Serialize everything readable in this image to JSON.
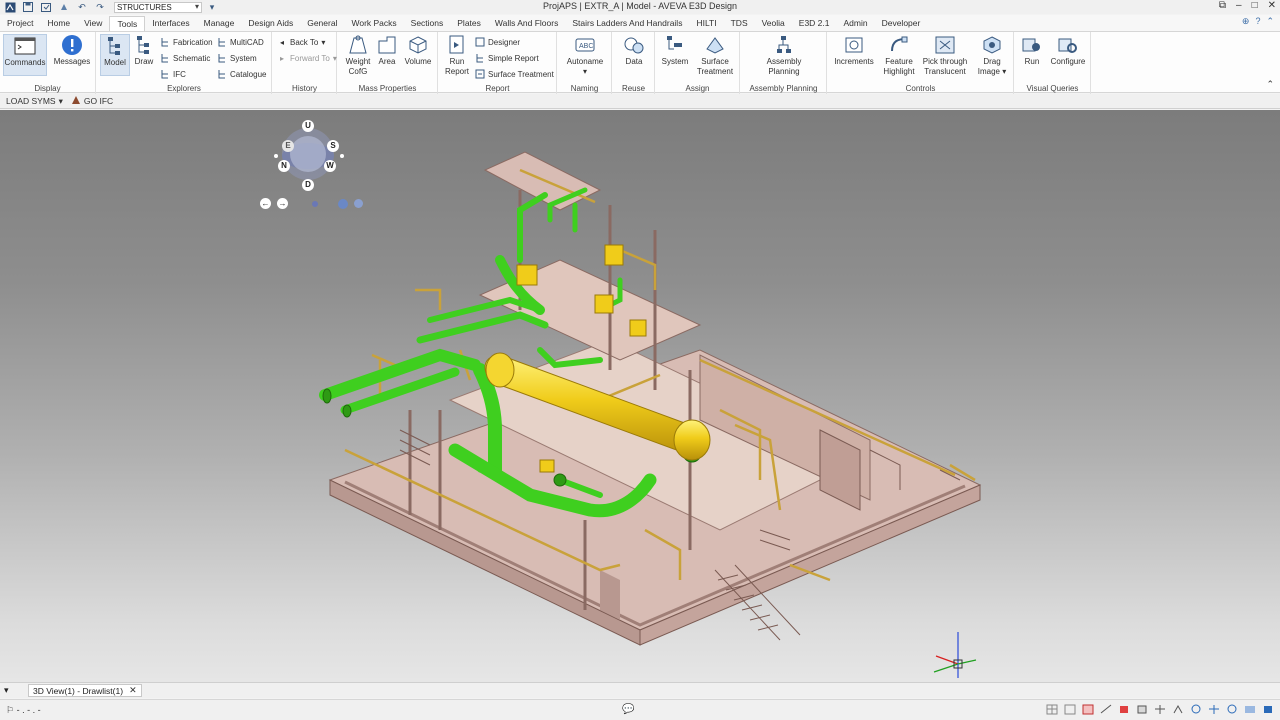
{
  "titlebar": {
    "title": "ProjAPS | EXTR_A | Model - AVEVA E3D Design",
    "combo_value": "STRUCTURES",
    "window_controls": [
      "minimize-icon",
      "restore-icon",
      "close-icon"
    ]
  },
  "tabs": [
    "Project",
    "Home",
    "View",
    "Tools",
    "Interfaces",
    "Manage",
    "Design Aids",
    "General",
    "Work Packs",
    "Sections",
    "Plates",
    "Walls And Floors",
    "Stairs Ladders And Handrails",
    "HILTI",
    "TDS",
    "Veolia",
    "E3D 2.1",
    "Admin",
    "Developer"
  ],
  "active_tab": "Tools",
  "ribbon": {
    "display": {
      "label": "Display",
      "commands": "Commands",
      "messages": "Messages"
    },
    "explorers": {
      "label": "Explorers",
      "model": "Model",
      "draw": "Draw",
      "fabrication": "Fabrication",
      "schematic": "Schematic",
      "ifc": "IFC",
      "multicad": "MultiCAD",
      "system": "System",
      "catalogue": "Catalogue"
    },
    "history": {
      "label": "History",
      "back_to": "Back To",
      "forward_to": "Forward To"
    },
    "mass": {
      "label": "Mass Properties",
      "weight": "Weight",
      "cofg": "CofG",
      "area": "Area",
      "volume": "Volume"
    },
    "report": {
      "label": "Report",
      "run": "Run",
      "report_word": "Report",
      "designer": "Designer",
      "simple_report": "Simple Report",
      "surface_treatment": "Surface Treatment"
    },
    "naming": {
      "label": "Naming",
      "autoname": "Autoname"
    },
    "reuse": {
      "label": "Reuse",
      "data": "Data"
    },
    "assign": {
      "label": "Assign",
      "system": "System",
      "surface": "Surface",
      "treatment": "Treatment"
    },
    "assembly": {
      "label": "Assembly Planning",
      "line1": "Assembly",
      "line2": "Planning"
    },
    "controls": {
      "label": "Controls",
      "increments": "Increments",
      "feature": "Feature",
      "highlight": "Highlight",
      "pick_through": "Pick through",
      "translucent": "Translucent",
      "drag": "Drag",
      "image": "Image"
    },
    "visual": {
      "label": "Visual Queries",
      "run": "Run",
      "configure": "Configure"
    }
  },
  "quickbar": {
    "load_syms": "LOAD SYMS",
    "go_ifc": "GO IFC"
  },
  "viewcube": {
    "up": "U",
    "down": "D",
    "north": "N",
    "south": "S",
    "east": "E",
    "west": "W"
  },
  "doc_tab": {
    "label": "3D View(1) - Drawlist(1)"
  },
  "status": {
    "left": "- . - . -"
  },
  "colors": {
    "pipe_green": "#3fcf1f",
    "vessel_yellow": "#f0cc1a",
    "structure_pink": "#d8bcb4",
    "handrail_gold": "#c9a23a",
    "accent_blue": "#3d6ea8"
  }
}
